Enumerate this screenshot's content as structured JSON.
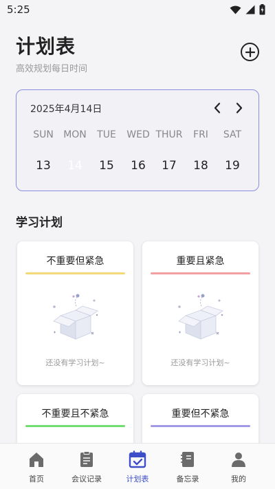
{
  "status_bar": {
    "time": "5:25"
  },
  "header": {
    "title": "计划表",
    "subtitle": "高效规划每日时间",
    "add_icon": "plus-circle-icon"
  },
  "calendar": {
    "current_date": "2025年4月14日",
    "weekdays": [
      "SUN",
      "MON",
      "TUE",
      "WED",
      "THUR",
      "FRI",
      "SAT"
    ],
    "days": [
      "13",
      "14",
      "15",
      "16",
      "17",
      "18",
      "19"
    ],
    "selected_day": "14",
    "accent_color": "#4460e8",
    "border_color": "#8b8ee0"
  },
  "section": {
    "title": "学习计划"
  },
  "plans": [
    {
      "title": "不重要但紧急",
      "line_color": "#f2d97a",
      "empty_text": "还没有学习计划~"
    },
    {
      "title": "重要且紧急",
      "line_color": "#f19f9f",
      "empty_text": "还没有学习计划~"
    },
    {
      "title": "不重要且不紧急",
      "line_color": "#6fdd6f",
      "empty_text": ""
    },
    {
      "title": "重要但不紧急",
      "line_color": "#9f99e6",
      "empty_text": ""
    }
  ],
  "bottom_nav": {
    "items": [
      {
        "label": "首页",
        "icon": "home-icon"
      },
      {
        "label": "会议记录",
        "icon": "clipboard-icon"
      },
      {
        "label": "计划表",
        "icon": "calendar-check-icon"
      },
      {
        "label": "备忘录",
        "icon": "notebook-icon"
      },
      {
        "label": "我的",
        "icon": "user-icon"
      }
    ],
    "active_index": 2
  }
}
